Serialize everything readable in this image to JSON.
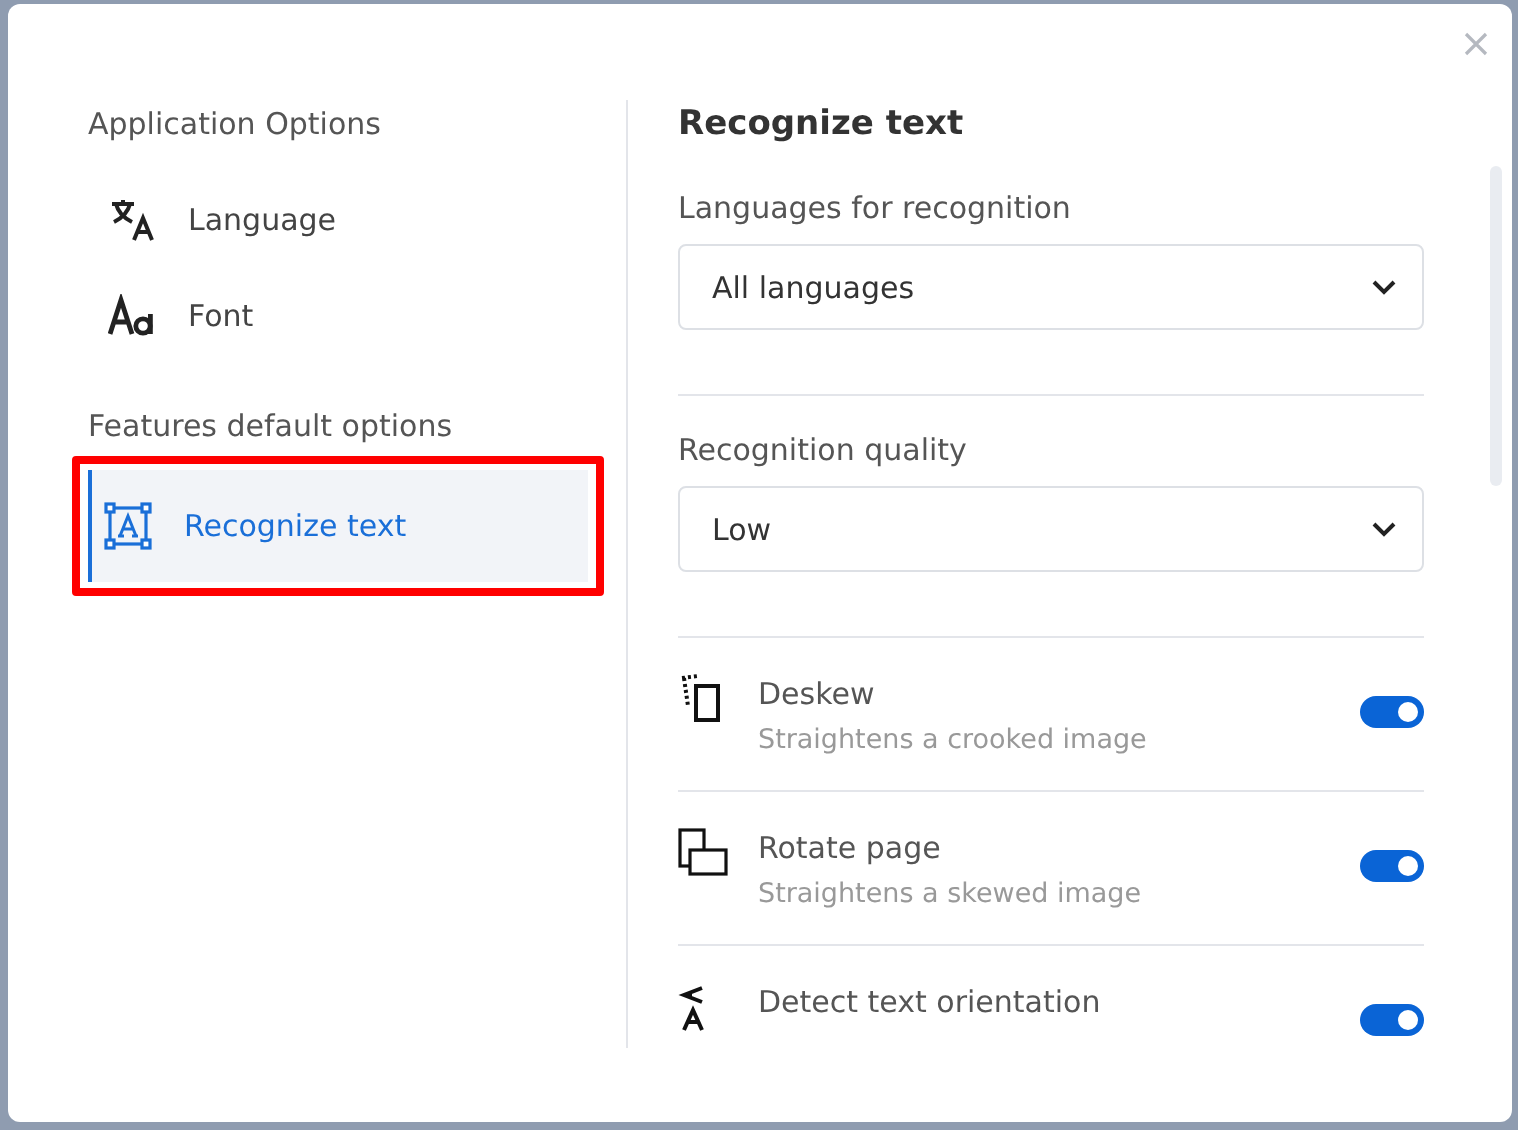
{
  "sidebar": {
    "sections": [
      {
        "heading": "Application Options",
        "items": [
          {
            "label": "Language",
            "kind": "language",
            "selected": false,
            "highlighted": false
          },
          {
            "label": "Font",
            "kind": "font",
            "selected": false,
            "highlighted": false
          }
        ]
      },
      {
        "heading": "Features default options",
        "items": [
          {
            "label": "Recognize text",
            "kind": "recognize",
            "selected": true,
            "highlighted": true
          }
        ]
      }
    ]
  },
  "panel": {
    "title": "Recognize text",
    "fields": [
      {
        "label": "Languages for recognition",
        "value": "All languages"
      },
      {
        "label": "Recognition quality",
        "value": "Low"
      }
    ],
    "options": [
      {
        "kind": "deskew",
        "title": "Deskew",
        "description": "Straightens a crooked image",
        "on": true
      },
      {
        "kind": "rotate",
        "title": "Rotate page",
        "description": "Straightens a skewed image",
        "on": true
      },
      {
        "kind": "orientation",
        "title": "Detect text orientation",
        "on": true
      }
    ]
  }
}
